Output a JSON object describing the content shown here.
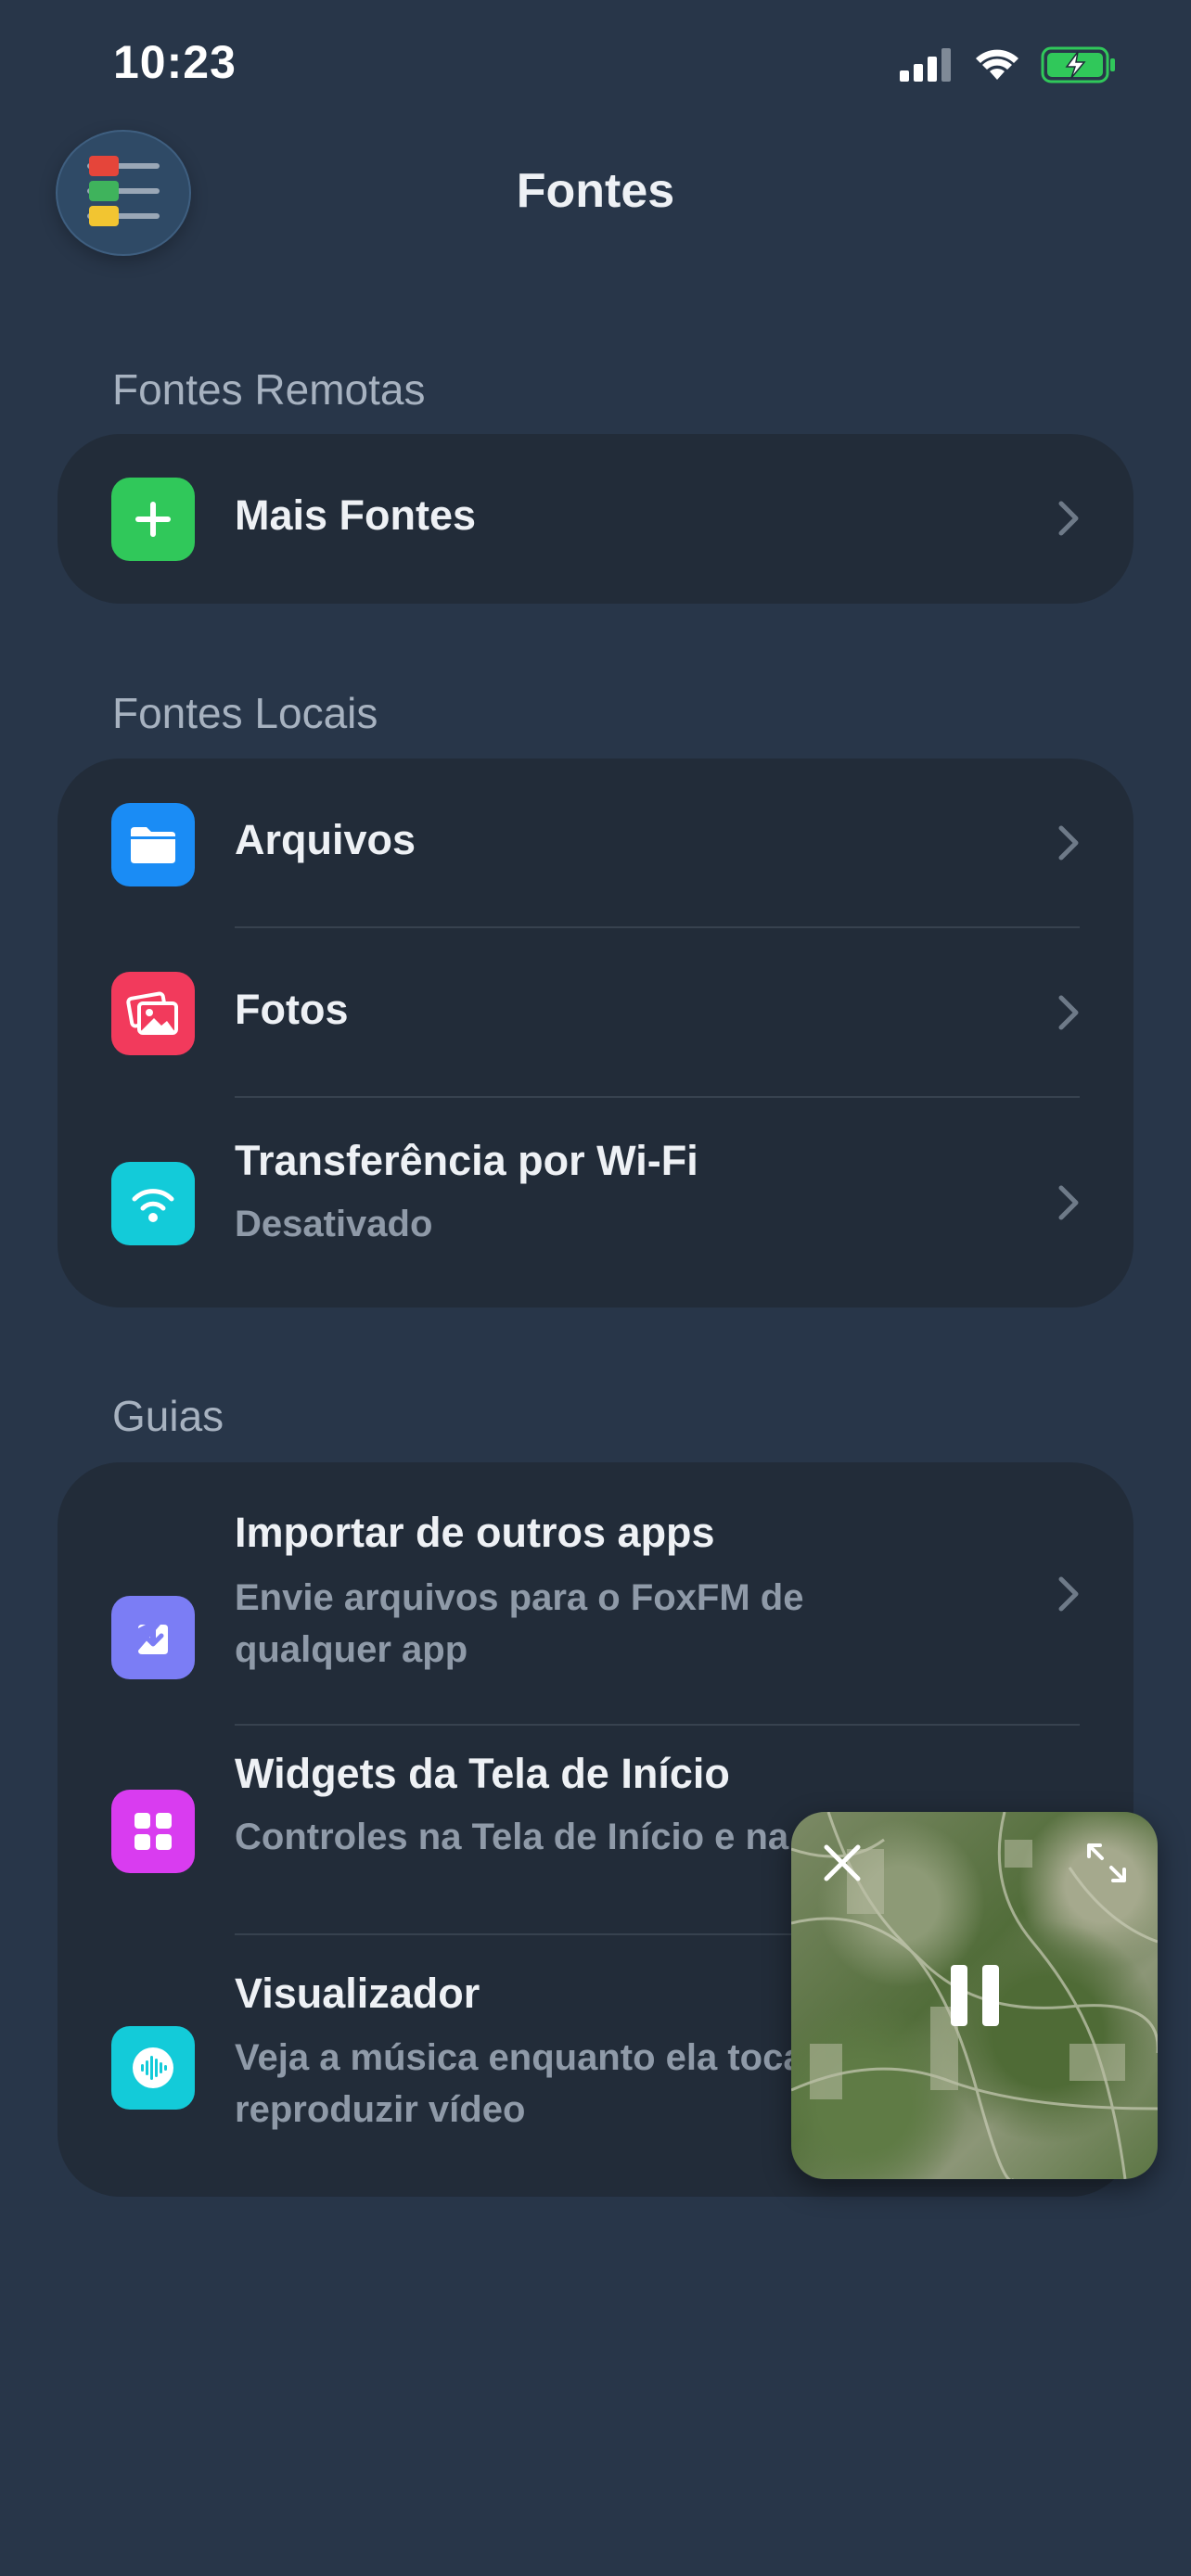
{
  "status_bar": {
    "time": "10:23"
  },
  "header": {
    "title": "Fontes"
  },
  "sections": {
    "remote": {
      "title": "Fontes Remotas",
      "items": [
        {
          "label": "Mais Fontes",
          "icon": "plus-icon",
          "color": "#30c85a"
        }
      ]
    },
    "local": {
      "title": "Fontes Locais",
      "items": [
        {
          "label": "Arquivos",
          "icon": "folder-icon",
          "color": "#1a8cf5"
        },
        {
          "label": "Fotos",
          "icon": "photos-icon",
          "color": "#f23a5c"
        },
        {
          "label": "Transferência por Wi-Fi",
          "sub": "Desativado",
          "icon": "wifi-icon",
          "color": "#13cbd9"
        }
      ]
    },
    "guides": {
      "title": "Guias",
      "items": [
        {
          "label": "Importar de outros apps",
          "sub1": "Envie arquivos para o FoxFM de",
          "sub2": "qualquer app",
          "icon": "import-icon",
          "color": "#7b7df5"
        },
        {
          "label": "Widgets da Tela de Início",
          "sub1": "Controles na Tela de Início e na",
          "icon": "widgets-icon",
          "color": "#d93cf0"
        },
        {
          "label": "Visualizador",
          "sub1": "Veja a música enquanto ela toca",
          "sub2": "reproduzir vídeo",
          "icon": "waveform-icon",
          "color": "#13cbd9"
        }
      ]
    }
  }
}
